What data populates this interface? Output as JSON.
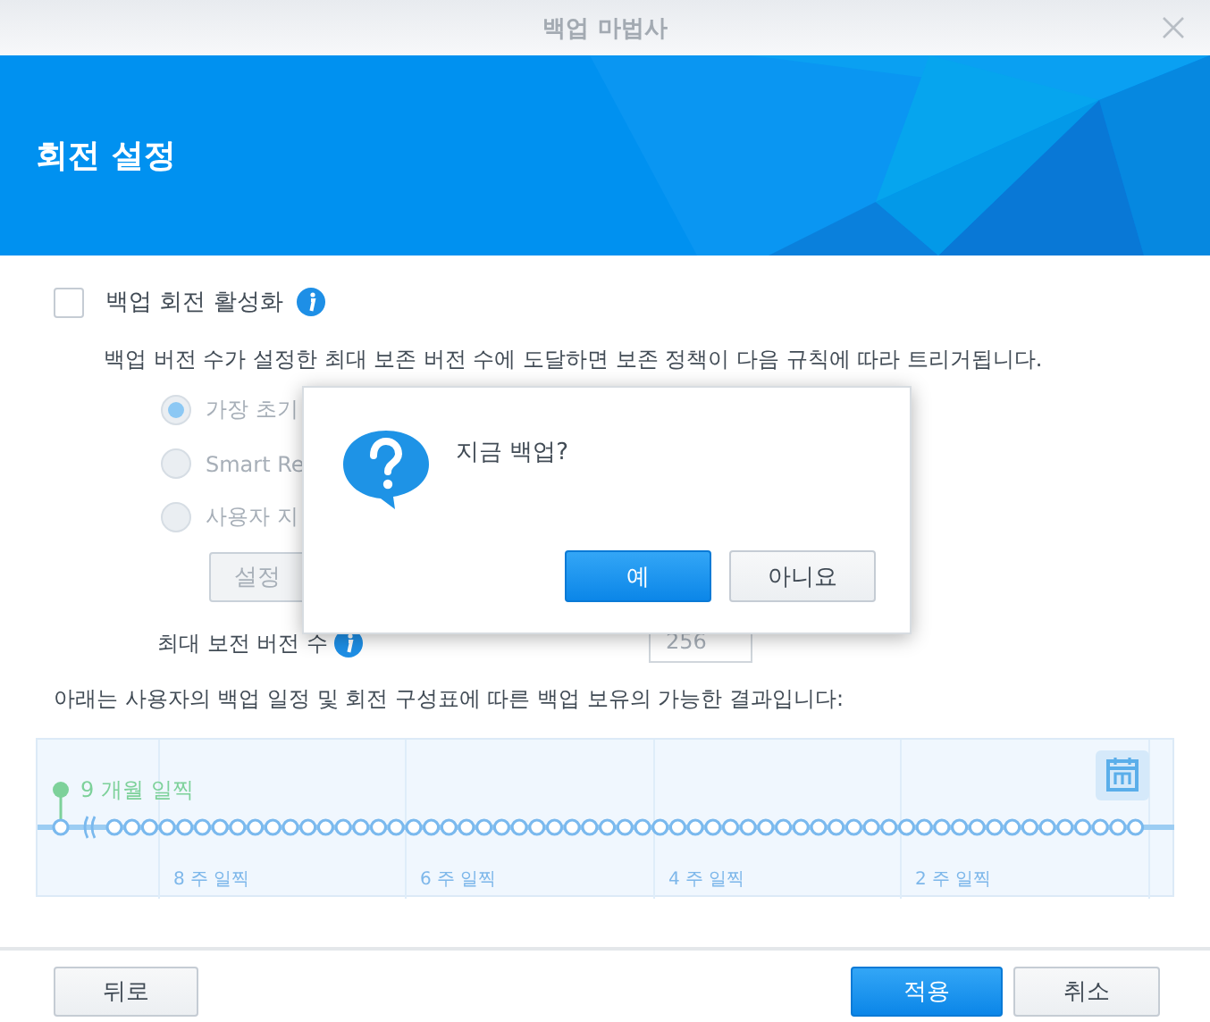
{
  "window": {
    "title": "백업 마법사"
  },
  "header": {
    "title": "회전 설정"
  },
  "rotation": {
    "label": "백업 회전 활성화",
    "checked": false
  },
  "description": "백업 버전 수가 설정한 최대 보존 버전 수에 도달하면 보존 정책이 다음 규칙에 따라 트리거됩니다.",
  "options": [
    {
      "label": "가장 초기",
      "selected": true
    },
    {
      "label": "Smart Re",
      "selected": false
    },
    {
      "label": "사용자 지",
      "selected": false
    }
  ],
  "settings_button": "설정",
  "max_versions": {
    "label": "최대 보전 버전 수",
    "value": "256"
  },
  "timeline": {
    "caption": "아래는 사용자의 백업 일정 및 회전 구성표에 따른 백업 보유의 가능한 결과입니다:",
    "start_label": "9 개월 일찍",
    "labels": [
      "8 주 일찍",
      "6 주 일찍",
      "4 주 일찍",
      "2 주 일찍"
    ]
  },
  "dialog": {
    "message": "지금 백업?",
    "buttons": [
      {
        "label": "예",
        "primary": true
      },
      {
        "label": "아니요",
        "primary": false
      }
    ]
  },
  "footer": {
    "back": "뒤로",
    "apply": "적용",
    "cancel": "취소"
  }
}
